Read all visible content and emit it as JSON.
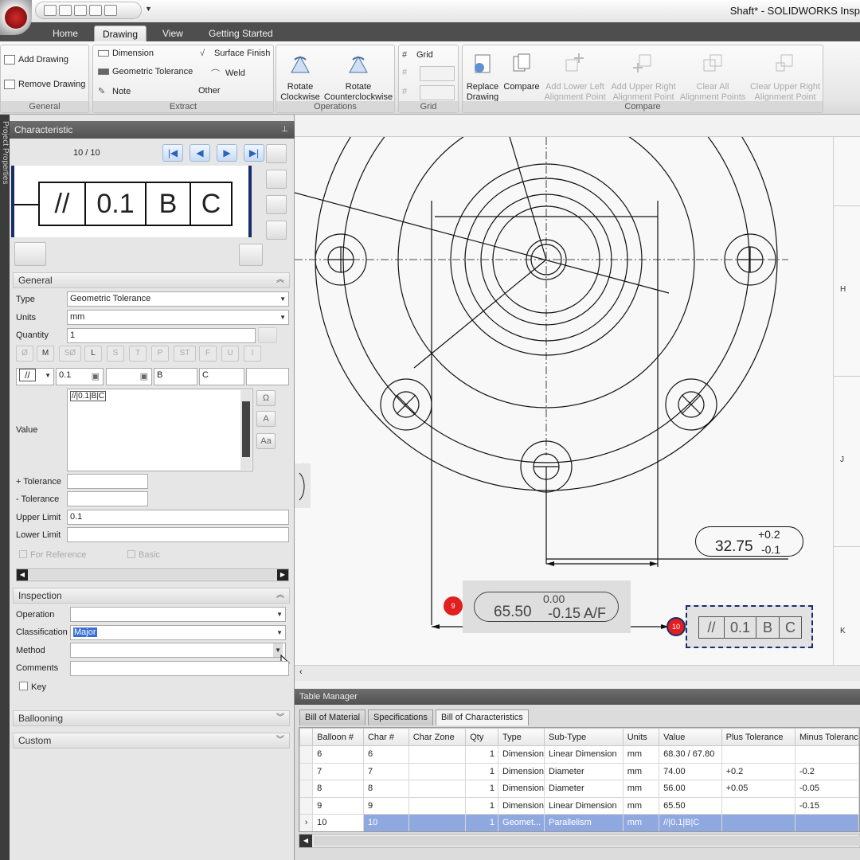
{
  "window": {
    "title": "Shaft* - SOLIDWORKS Insp"
  },
  "tabs": [
    "Home",
    "Drawing",
    "View",
    "Getting Started"
  ],
  "ribbon": {
    "general": {
      "label": "General",
      "add_drawing": "Add Drawing",
      "remove_drawing": "Remove Drawing"
    },
    "extract": {
      "label": "Extract",
      "dimension": "Dimension",
      "geometric_tolerance": "Geometric Tolerance",
      "note": "Note",
      "surface_finish": "Surface Finish",
      "weld": "Weld",
      "other": "Other"
    },
    "operations": {
      "label": "Operations",
      "rotate_cw": [
        "Rotate",
        "Clockwise"
      ],
      "rotate_ccw": [
        "Rotate",
        "Counterclockwise"
      ]
    },
    "grid": {
      "label": "Grid",
      "grid": "Grid"
    },
    "compare": {
      "label": "Compare",
      "replace_drawing": [
        "Replace",
        "Drawing"
      ],
      "compare": "Compare",
      "add_lower_left": [
        "Add Lower Left",
        "Alignment Point"
      ],
      "add_upper_right": [
        "Add Upper Right",
        "Alignment Point"
      ],
      "clear_all": [
        "Clear All",
        "Alignment Points"
      ],
      "clear_upper_right": [
        "Clear Upper Right",
        "Alignment Point"
      ]
    }
  },
  "left_strip": "Project Properties",
  "characteristic": {
    "title": "Characteristic",
    "counter": "10 / 10",
    "fcf": {
      "symbol": "//",
      "tolerance": "0.1",
      "datum1": "B",
      "datum2": "C"
    }
  },
  "general": {
    "title": "General",
    "type_label": "Type",
    "type_value": "Geometric Tolerance",
    "units_label": "Units",
    "units_value": "mm",
    "quantity_label": "Quantity",
    "quantity_value": "1",
    "modifiers": [
      "Ø",
      "M",
      "SØ",
      "L",
      "S",
      "T",
      "P",
      "ST",
      "F",
      "U",
      "I"
    ],
    "fcf_row": {
      "symbol": "//",
      "tol": "0.1",
      "d1": "B",
      "d2": "C"
    },
    "value_label": "Value",
    "value_text": "//|0.1|B|C",
    "plus_tol_label": "+ Tolerance",
    "minus_tol_label": "- Tolerance",
    "upper_label": "Upper Limit",
    "upper_value": "0.1",
    "lower_label": "Lower Limit",
    "for_reference": "For Reference",
    "basic": "Basic"
  },
  "inspection": {
    "title": "Inspection",
    "operation_label": "Operation",
    "classification_label": "Classification",
    "classification_value": "Major",
    "method_label": "Method",
    "comments_label": "Comments",
    "key_label": "Key"
  },
  "ballooning": {
    "title": "Ballooning"
  },
  "custom": {
    "title": "Custom"
  },
  "drawing": {
    "zones": [
      "H",
      "J",
      "K"
    ],
    "dim1": {
      "plus": "+0.2",
      "main": "32.75",
      "minus": "-0.1"
    },
    "dim2": {
      "upper": "0.00",
      "main": "65.50",
      "lower": "-0.15 A/F"
    },
    "balloon9": "9",
    "balloon10": "10",
    "fcf": {
      "symbol": "//",
      "tol": "0.1",
      "d1": "B",
      "d2": "C"
    }
  },
  "table_manager": {
    "title": "Table Manager",
    "tabs": [
      "Bill of Material",
      "Specifications",
      "Bill of Characteristics"
    ],
    "columns": [
      "Balloon #",
      "Char #",
      "Char Zone",
      "Qty",
      "Type",
      "Sub-Type",
      "Units",
      "Value",
      "Plus Tolerance",
      "Minus Toleranc"
    ],
    "rows": [
      [
        "6",
        "6",
        "",
        "1",
        "Dimension",
        "Linear Dimension",
        "mm",
        "68.30 / 67.80",
        "",
        ""
      ],
      [
        "7",
        "7",
        "",
        "1",
        "Dimension",
        "Diameter",
        "mm",
        "74.00",
        "+0.2",
        "-0.2"
      ],
      [
        "8",
        "8",
        "",
        "1",
        "Dimension",
        "Diameter",
        "mm",
        "56.00",
        "+0.05",
        "-0.05"
      ],
      [
        "9",
        "9",
        "",
        "1",
        "Dimension",
        "Linear Dimension",
        "mm",
        "65.50",
        "",
        "-0.15"
      ],
      [
        "10",
        "10",
        "",
        "1",
        "Geomet...",
        "Parallelism",
        "mm",
        "//|0.1|B|C",
        "",
        ""
      ]
    ]
  }
}
